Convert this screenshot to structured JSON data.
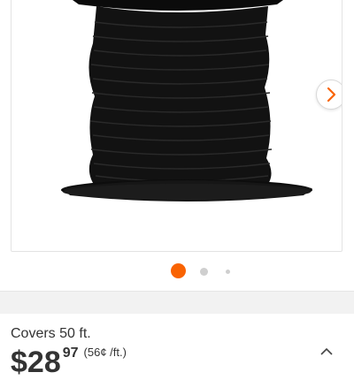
{
  "product": {
    "image_icon": "wire-spool-image",
    "carousel": {
      "next_icon": "chevron-right-icon",
      "active_color": "#f96302",
      "inactive_color": "#cfcfcf",
      "page_count": 3,
      "active_index": 0
    }
  },
  "details": {
    "coverage": "Covers 50 ft.",
    "price": {
      "dollar_sign": "$",
      "whole": "28",
      "cents": "97",
      "per_unit": "(56¢ /ft.)"
    },
    "expand_icon": "chevron-icon"
  }
}
